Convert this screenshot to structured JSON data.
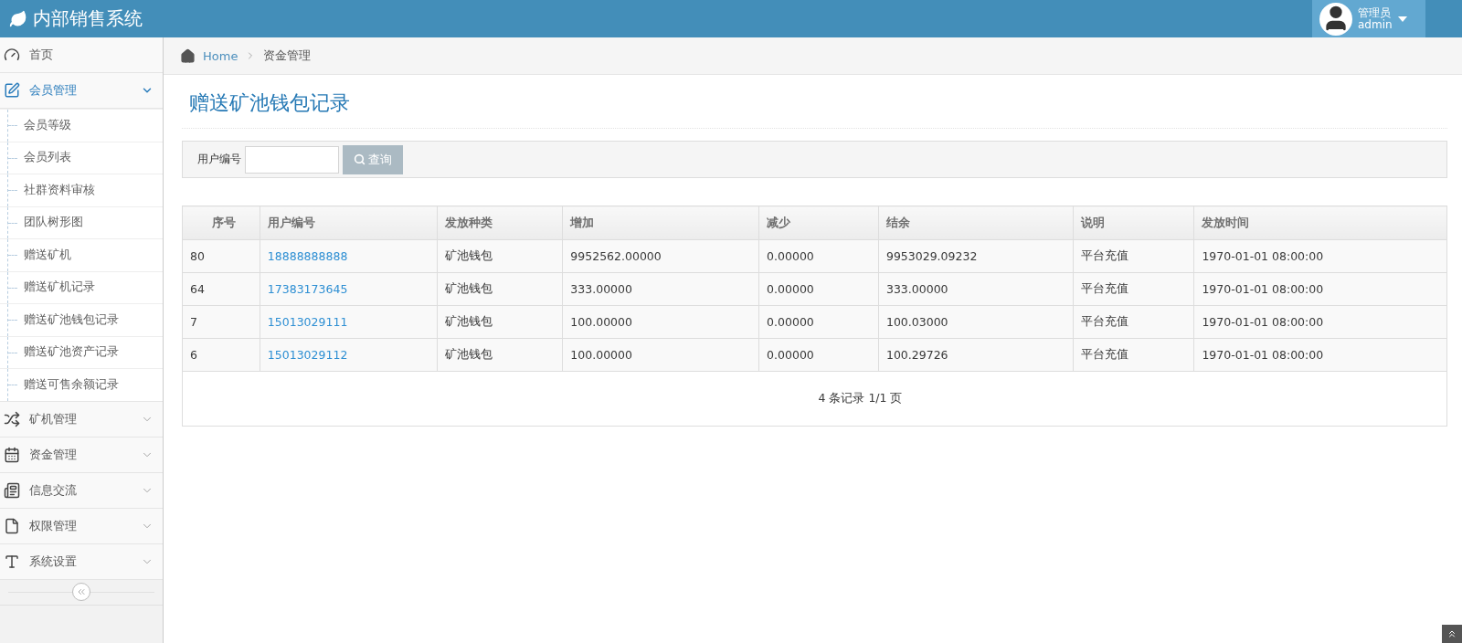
{
  "header": {
    "title": "内部销售系统",
    "user": {
      "role": "管理员",
      "name": "admin"
    }
  },
  "sidebar": {
    "items": [
      {
        "label": "首页",
        "selected": false
      },
      {
        "label": "会员管理",
        "selected": true,
        "expanded": true,
        "children": [
          {
            "label": "会员等级",
            "selected": false
          },
          {
            "label": "会员列表",
            "selected": false
          },
          {
            "label": "社群资料审核",
            "selected": false
          },
          {
            "label": "团队树形图",
            "selected": false
          },
          {
            "label": "赠送矿机",
            "selected": false
          },
          {
            "label": "赠送矿机记录",
            "selected": false
          },
          {
            "label": "赠送矿池钱包记录",
            "selected": false
          },
          {
            "label": "赠送矿池资产记录",
            "selected": false
          },
          {
            "label": "赠送可售余额记录",
            "selected": false
          }
        ]
      },
      {
        "label": "矿机管理",
        "selected": false,
        "expanded": false
      },
      {
        "label": "资金管理",
        "selected": false,
        "expanded": false
      },
      {
        "label": "信息交流",
        "selected": false,
        "expanded": false
      },
      {
        "label": "权限管理",
        "selected": false,
        "expanded": false
      },
      {
        "label": "系统设置",
        "selected": false,
        "expanded": false
      }
    ]
  },
  "breadcrumb": [
    "Home",
    "资金管理"
  ],
  "page_title": "赠送矿池钱包记录",
  "search": {
    "label": "用户编号",
    "button": "查询"
  },
  "table": {
    "columns": [
      "序号",
      "用户编号",
      "发放种类",
      "增加",
      "减少",
      "结余",
      "说明",
      "发放时间"
    ],
    "rows": [
      [
        "80",
        "18888888888",
        "矿池钱包",
        "9952562.00000",
        "0.00000",
        "9953029.09232",
        "平台充值",
        "1970-01-01 08:00:00"
      ],
      [
        "64",
        "17383173645",
        "矿池钱包",
        "333.00000",
        "0.00000",
        "333.00000",
        "平台充值",
        "1970-01-01 08:00:00"
      ],
      [
        "7",
        "15013029111",
        "矿池钱包",
        "100.00000",
        "0.00000",
        "100.03000",
        "平台充值",
        "1970-01-01 08:00:00"
      ],
      [
        "6",
        "15013029112",
        "矿池钱包",
        "100.00000",
        "0.00000",
        "100.29726",
        "平台充值",
        "1970-01-01 08:00:00"
      ]
    ]
  },
  "pagination": "4 条记录 1/1 页"
}
